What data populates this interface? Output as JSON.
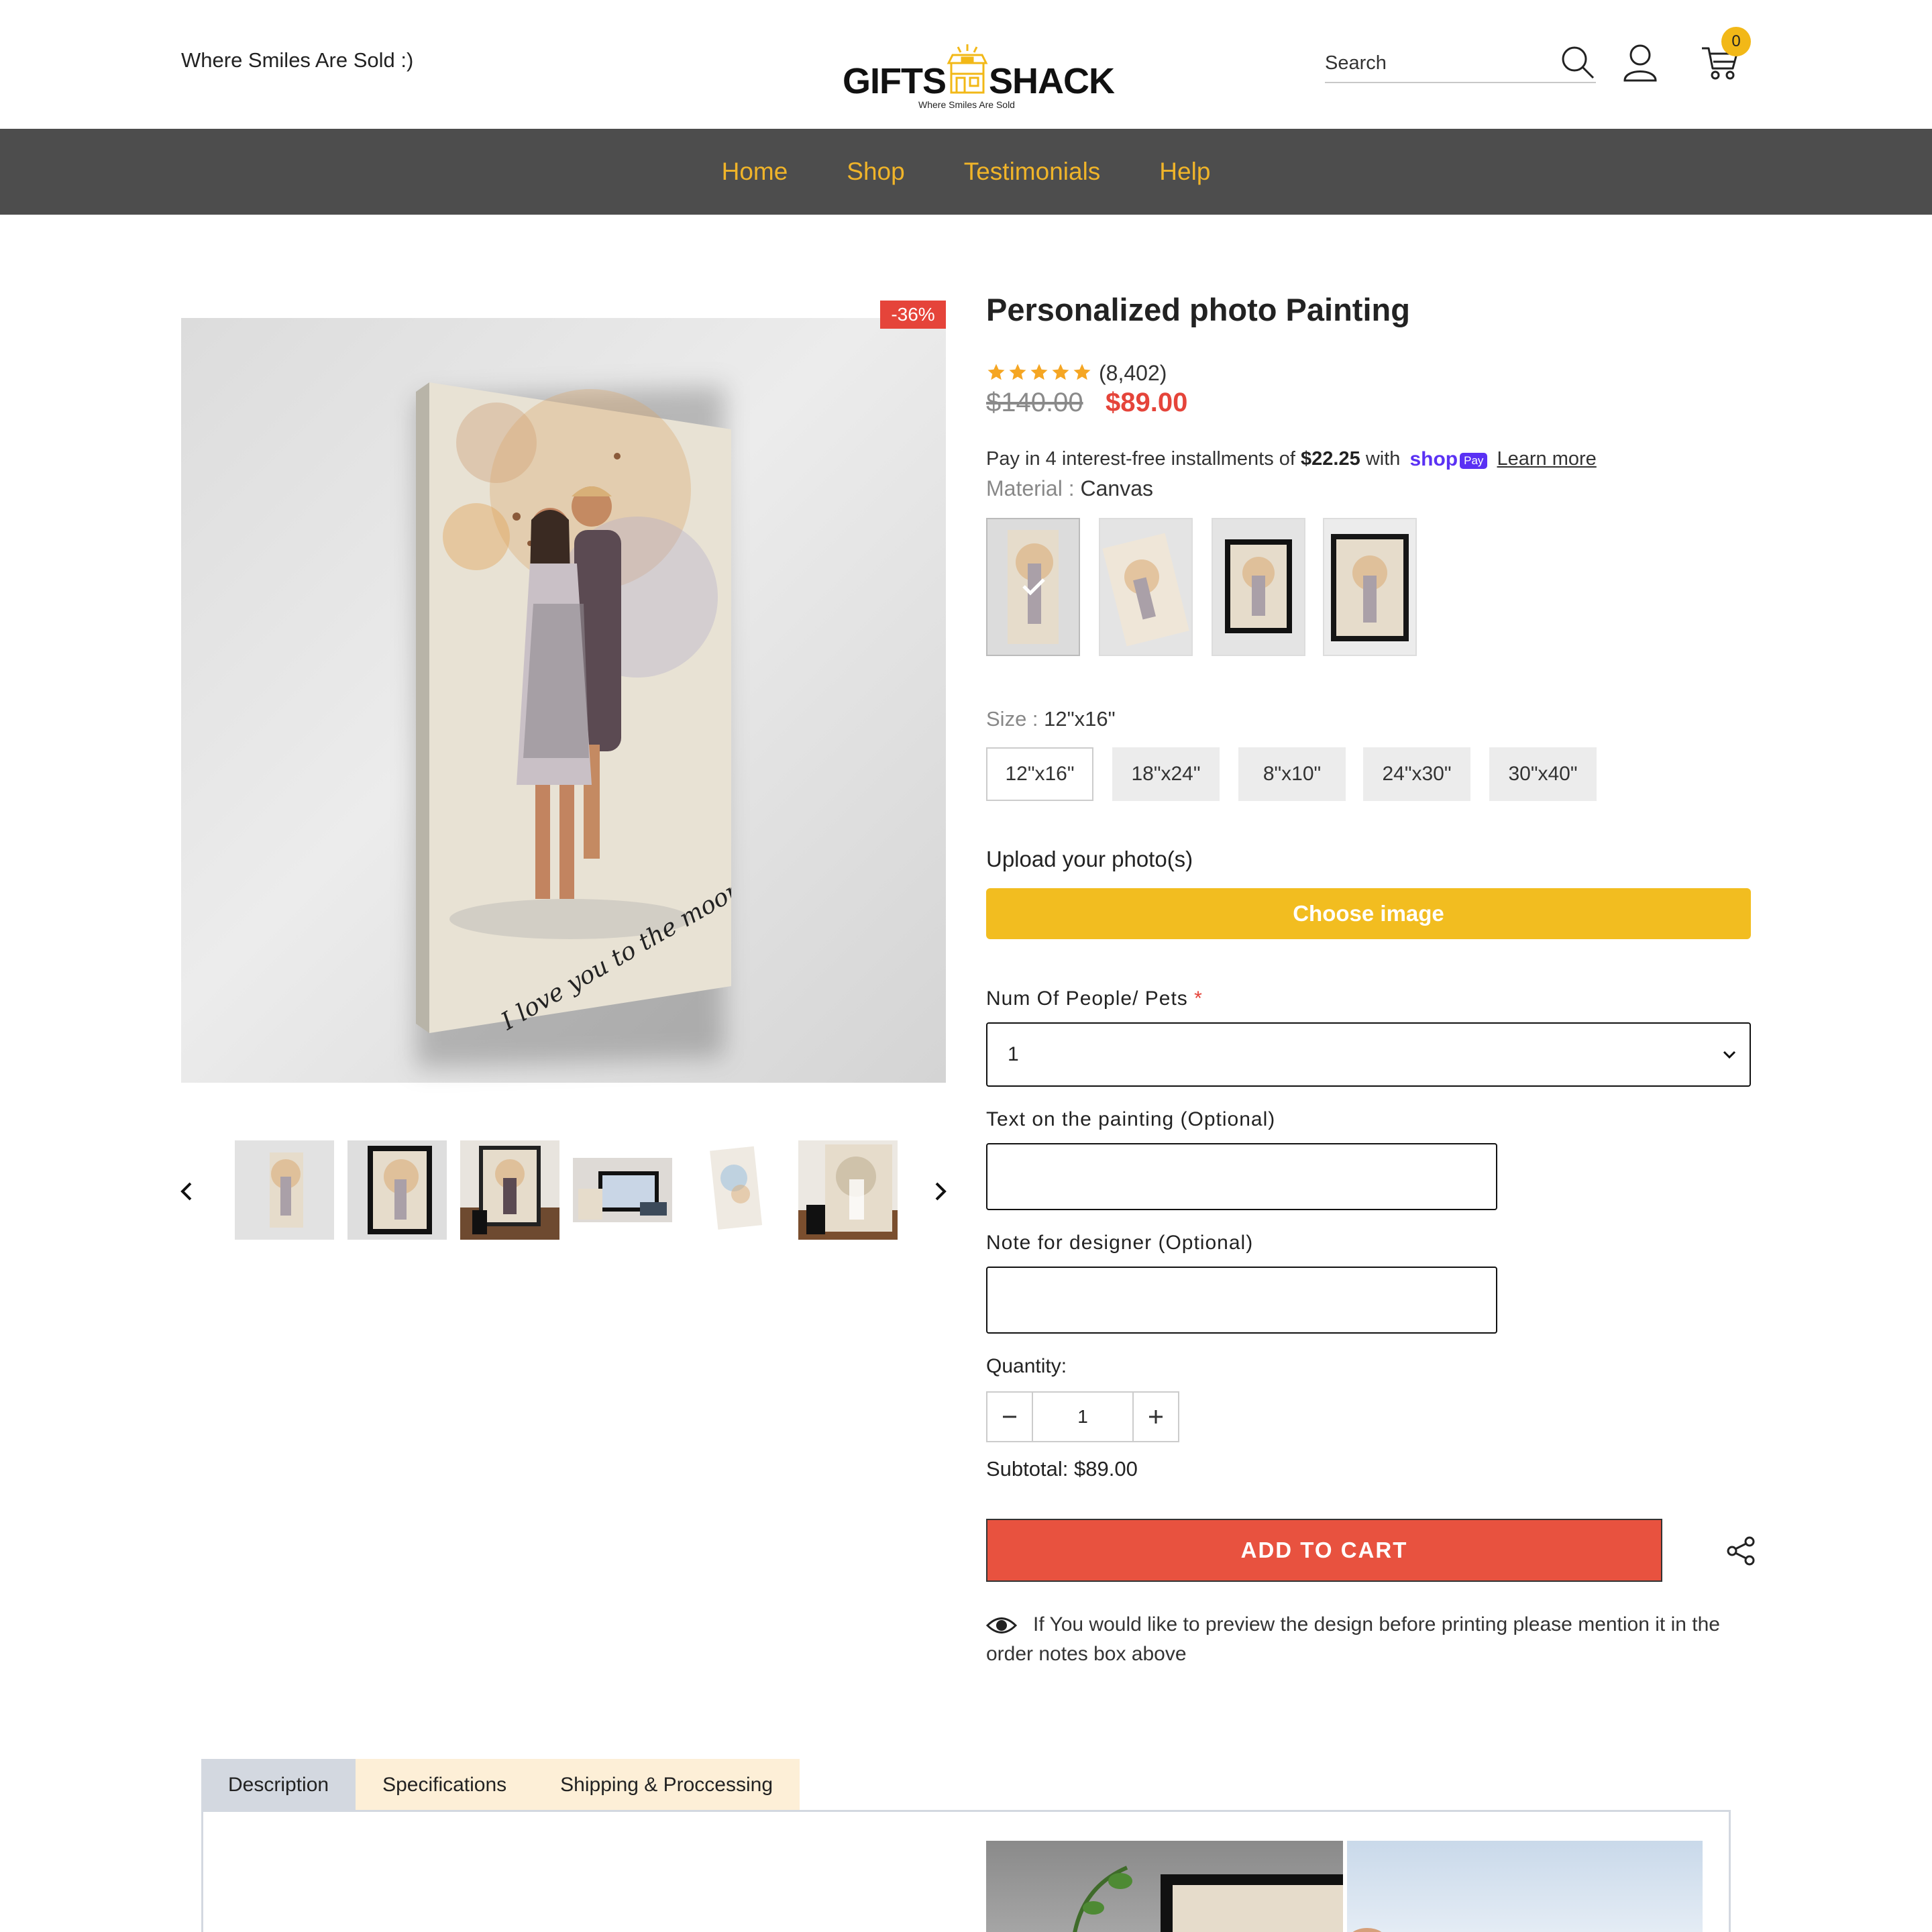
{
  "header": {
    "tagline": "Where Smiles Are Sold :)",
    "logo_left": "GIFTS",
    "logo_right": "SHACK",
    "logo_sub": "Where Smiles Are Sold",
    "search_placeholder": "Search",
    "cart_count": "0"
  },
  "nav": {
    "items": [
      "Home",
      "Shop",
      "Testimonials",
      "Help"
    ],
    "color": "#f0b429",
    "bg": "#4d4d4d"
  },
  "media": {
    "badge": "-36%",
    "painting_text": "I love you to the moon and back",
    "thumbnail_count": 6
  },
  "product": {
    "title": "Personalized photo Painting",
    "rating_stars": 5,
    "review_count": "(8,402)",
    "price_old": "$140.00",
    "price_new": "$89.00",
    "installments": {
      "prefix": "Pay in 4 interest-free installments of",
      "amount": "$22.25",
      "middle": "with",
      "shop_word": "shop",
      "pay_word": "Pay",
      "learn_more": "Learn more"
    },
    "material": {
      "label": "Material :",
      "value": "Canvas",
      "options": [
        "canvas",
        "poster",
        "framed-light",
        "framed-dark"
      ]
    },
    "size": {
      "label": "Size :",
      "value": "12\"x16\"",
      "options": [
        "12\"x16\"",
        "18\"x24\"",
        "8\"x10\"",
        "24\"x30\"",
        "30\"x40\""
      ]
    },
    "upload_label": "Upload your photo(s)",
    "choose_image": "Choose image",
    "people_label": "Num Of People/ Pets",
    "people_required": "*",
    "people_value": "1",
    "text_label": "Text on the painting (Optional)",
    "note_label": "Note for designer (Optional)",
    "quantity_label": "Quantity:",
    "quantity_value": "1",
    "subtotal_label": "Subtotal:",
    "subtotal_value": "$89.00",
    "add_to_cart": "ADD TO CART",
    "preview_note": "If You would like to preview the design before printing please mention it in the order notes box above"
  },
  "tabs": {
    "items": [
      "Description",
      "Specifications",
      "Shipping & Proccessing"
    ],
    "active": "Description"
  },
  "colors": {
    "accent": "#f2bd20",
    "sale_red": "#e5443a",
    "cart_red": "#e8523f",
    "shop_pay": "#5a31f4"
  }
}
